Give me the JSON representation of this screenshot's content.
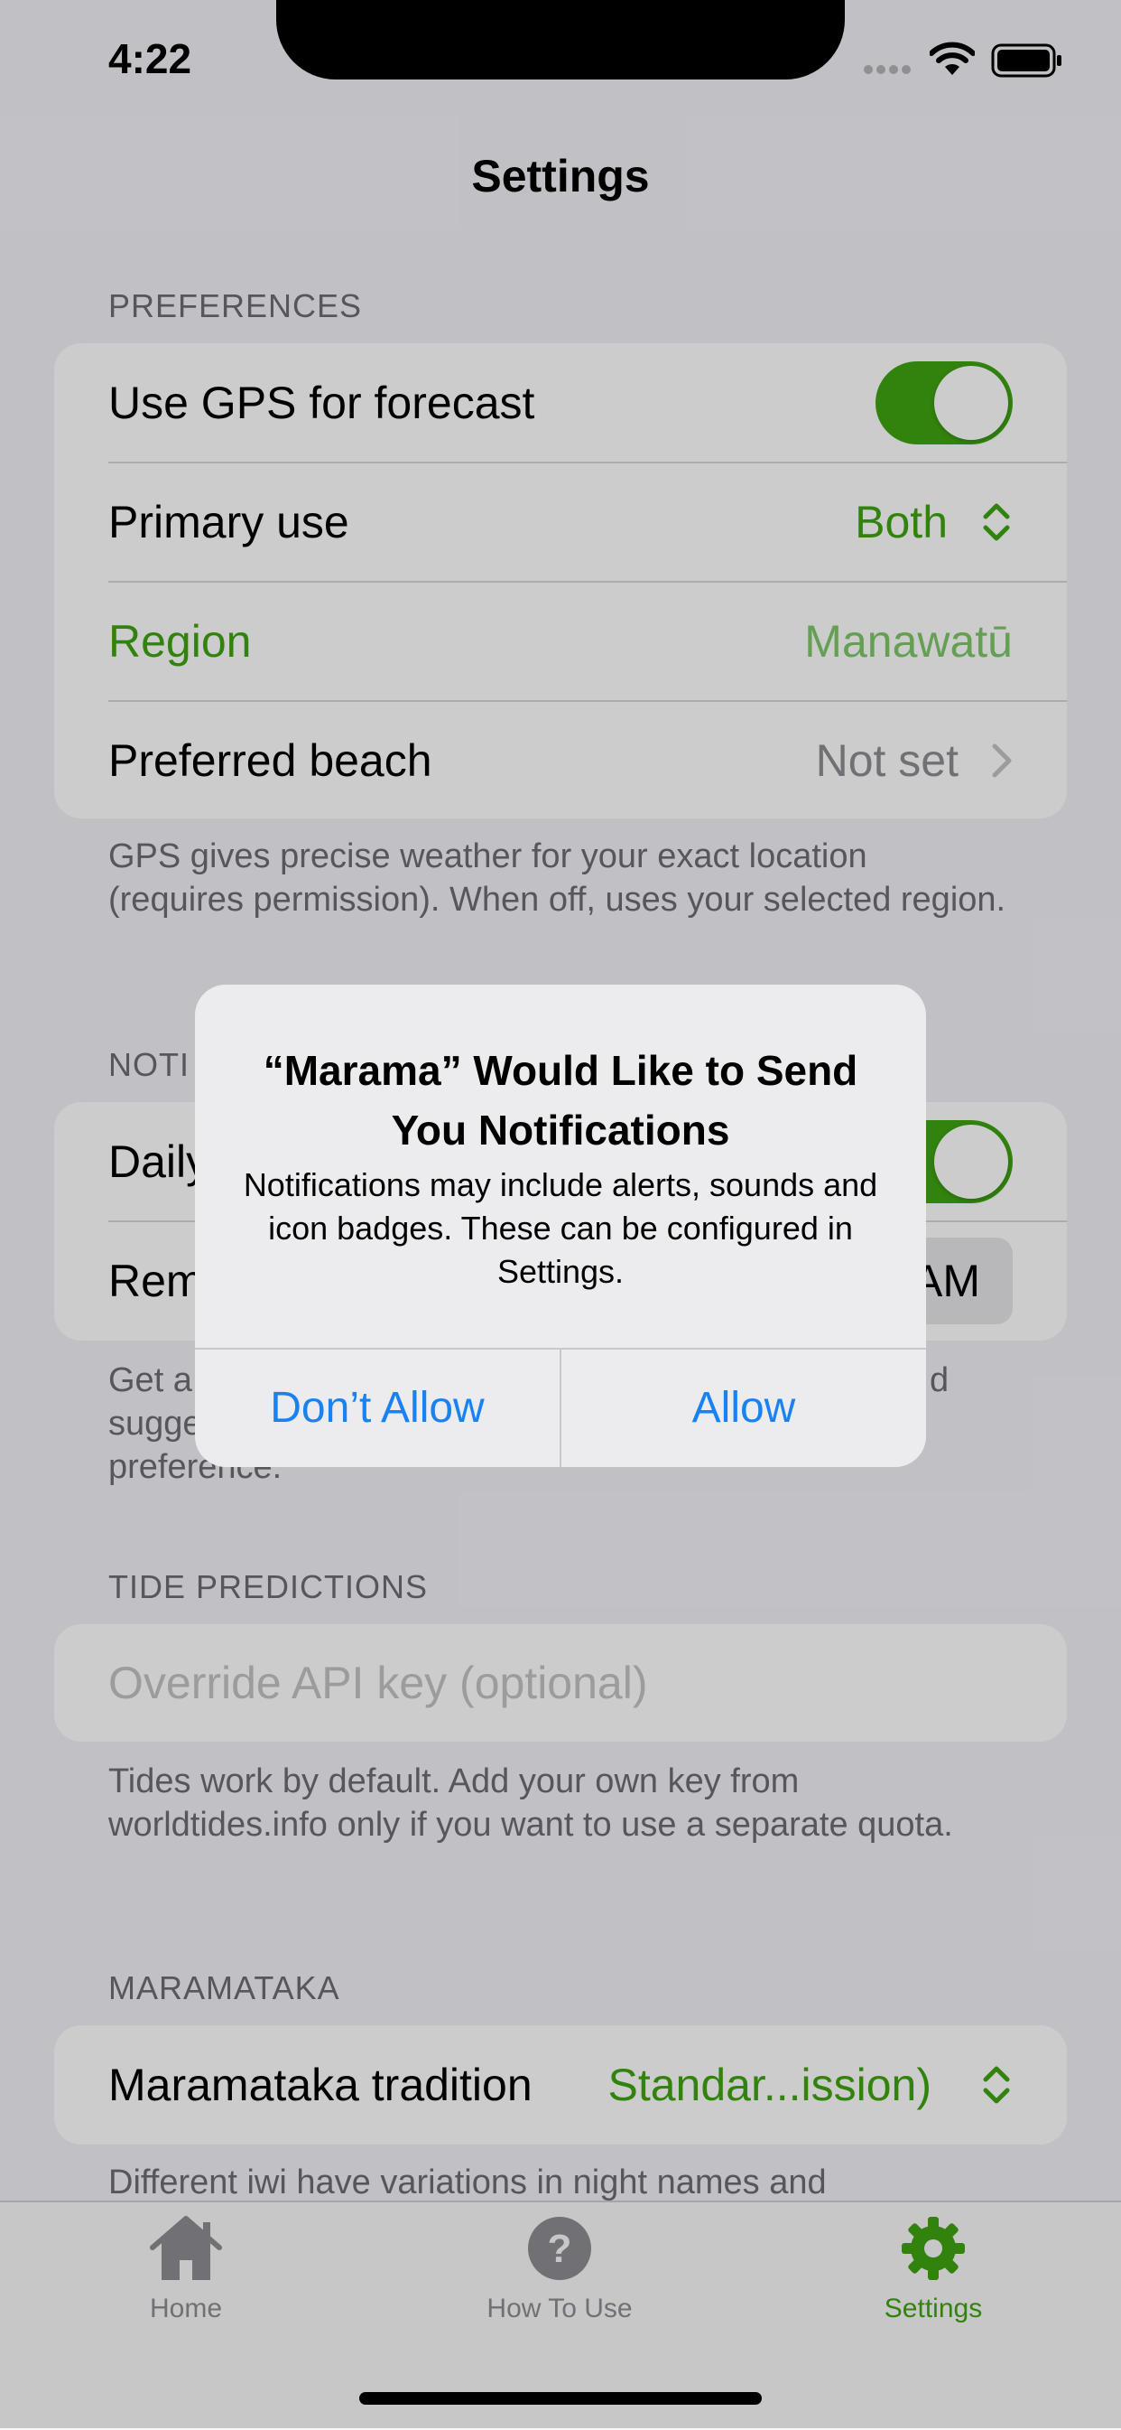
{
  "status_bar": {
    "time": "4:22"
  },
  "nav": {
    "title": "Settings"
  },
  "preferences": {
    "header": "PREFERENCES",
    "gps_label": "Use GPS for forecast",
    "primary_use_label": "Primary use",
    "primary_use_value": "Both",
    "region_label": "Region",
    "region_value": "Manawatū",
    "beach_label": "Preferred beach",
    "beach_value": "Not set",
    "footer": "GPS gives precise weather for your exact location (requires permission). When off, uses your selected region."
  },
  "notifications": {
    "header_partial": "NOTI",
    "daily_partial": "Daily",
    "reminder_partial": "Rem",
    "time_partial": "AM",
    "footer_line1": "Get a",
    "footer_line1_end": "d",
    "footer_line2": "sugge",
    "footer_line3": "preference."
  },
  "tides": {
    "header": "TIDE PREDICTIONS",
    "api_placeholder": "Override API key (optional)",
    "footer": "Tides work by default. Add your own key from worldtides.info only if you want to use a separate quota."
  },
  "maramataka": {
    "header": "MARAMATAKA",
    "tradition_label": "Maramataka tradition",
    "tradition_value": "Standar...ission)",
    "footer": "Different iwi have variations in night names and"
  },
  "tabs": [
    {
      "label": "Home",
      "icon": "house-icon"
    },
    {
      "label": "How To Use",
      "icon": "question-icon"
    },
    {
      "label": "Settings",
      "icon": "gear-icon"
    }
  ],
  "alert": {
    "title": "“Marama” Would Like to Send You Notifications",
    "message": "Notifications may include alerts, sounds and icon badges. These can be configured in Settings.",
    "deny_label": "Don’t Allow",
    "allow_label": "Allow"
  },
  "colors": {
    "accent": "#3fa412",
    "link": "#1a82f0"
  }
}
